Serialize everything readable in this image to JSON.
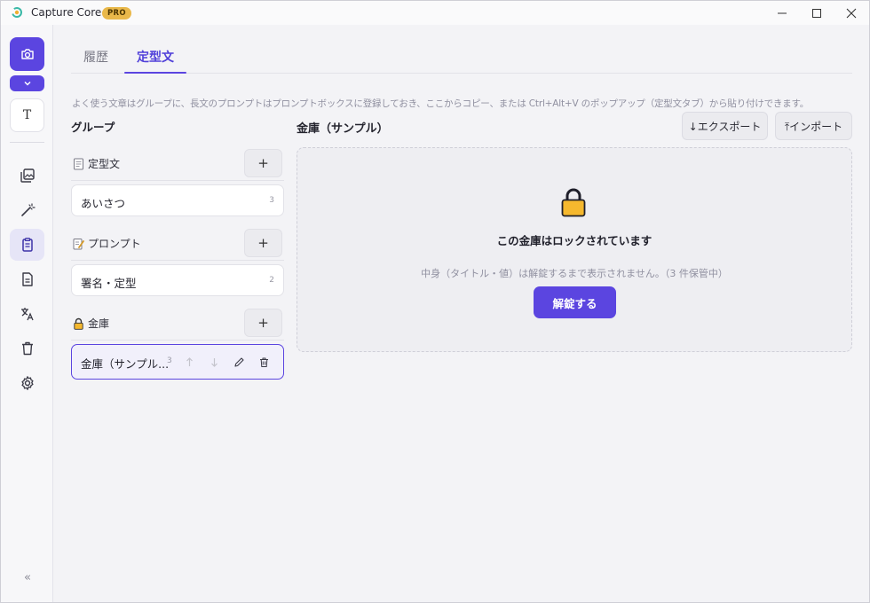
{
  "app": {
    "title": "Capture Core",
    "badge": "PRO"
  },
  "sidebar": {
    "text_tool_label": "T",
    "collapse_label": "«"
  },
  "tabs": [
    {
      "label": "履歴",
      "active": false
    },
    {
      "label": "定型文",
      "active": true
    }
  ],
  "hint": "よく使う文章はグループに、長文のプロンプトはプロンプトボックスに登録しておき、ここからコピー、または Ctrl+Alt+V のポップアップ（定型文タブ）から貼り付けできます。",
  "groups": {
    "heading": "グループ",
    "add_label": "+",
    "sections": [
      {
        "label": "定型文",
        "icon": "memo-icon",
        "items": [
          {
            "name": "あいさつ",
            "count": "3"
          }
        ]
      },
      {
        "label": "プロンプト",
        "icon": "pencil-memo-icon",
        "items": [
          {
            "name": "署名・定型",
            "count": "2"
          }
        ]
      },
      {
        "label": "金庫",
        "icon": "lock-icon",
        "items": [
          {
            "name": "金庫（サンプル...",
            "count": "3",
            "selected": true
          }
        ]
      }
    ]
  },
  "vault": {
    "title": "金庫（サンプル）",
    "export_label": "↓エクスポート",
    "import_label": "⤒インポート",
    "locked_message": "この金庫はロックされています",
    "locked_sub": "中身（タイトル・値）は解錠するまで表示されません。（3 件保管中）",
    "unlock_label": "解錠する"
  },
  "colors": {
    "accent": "#5b45e0",
    "lock_gold": "#f5b82e"
  }
}
